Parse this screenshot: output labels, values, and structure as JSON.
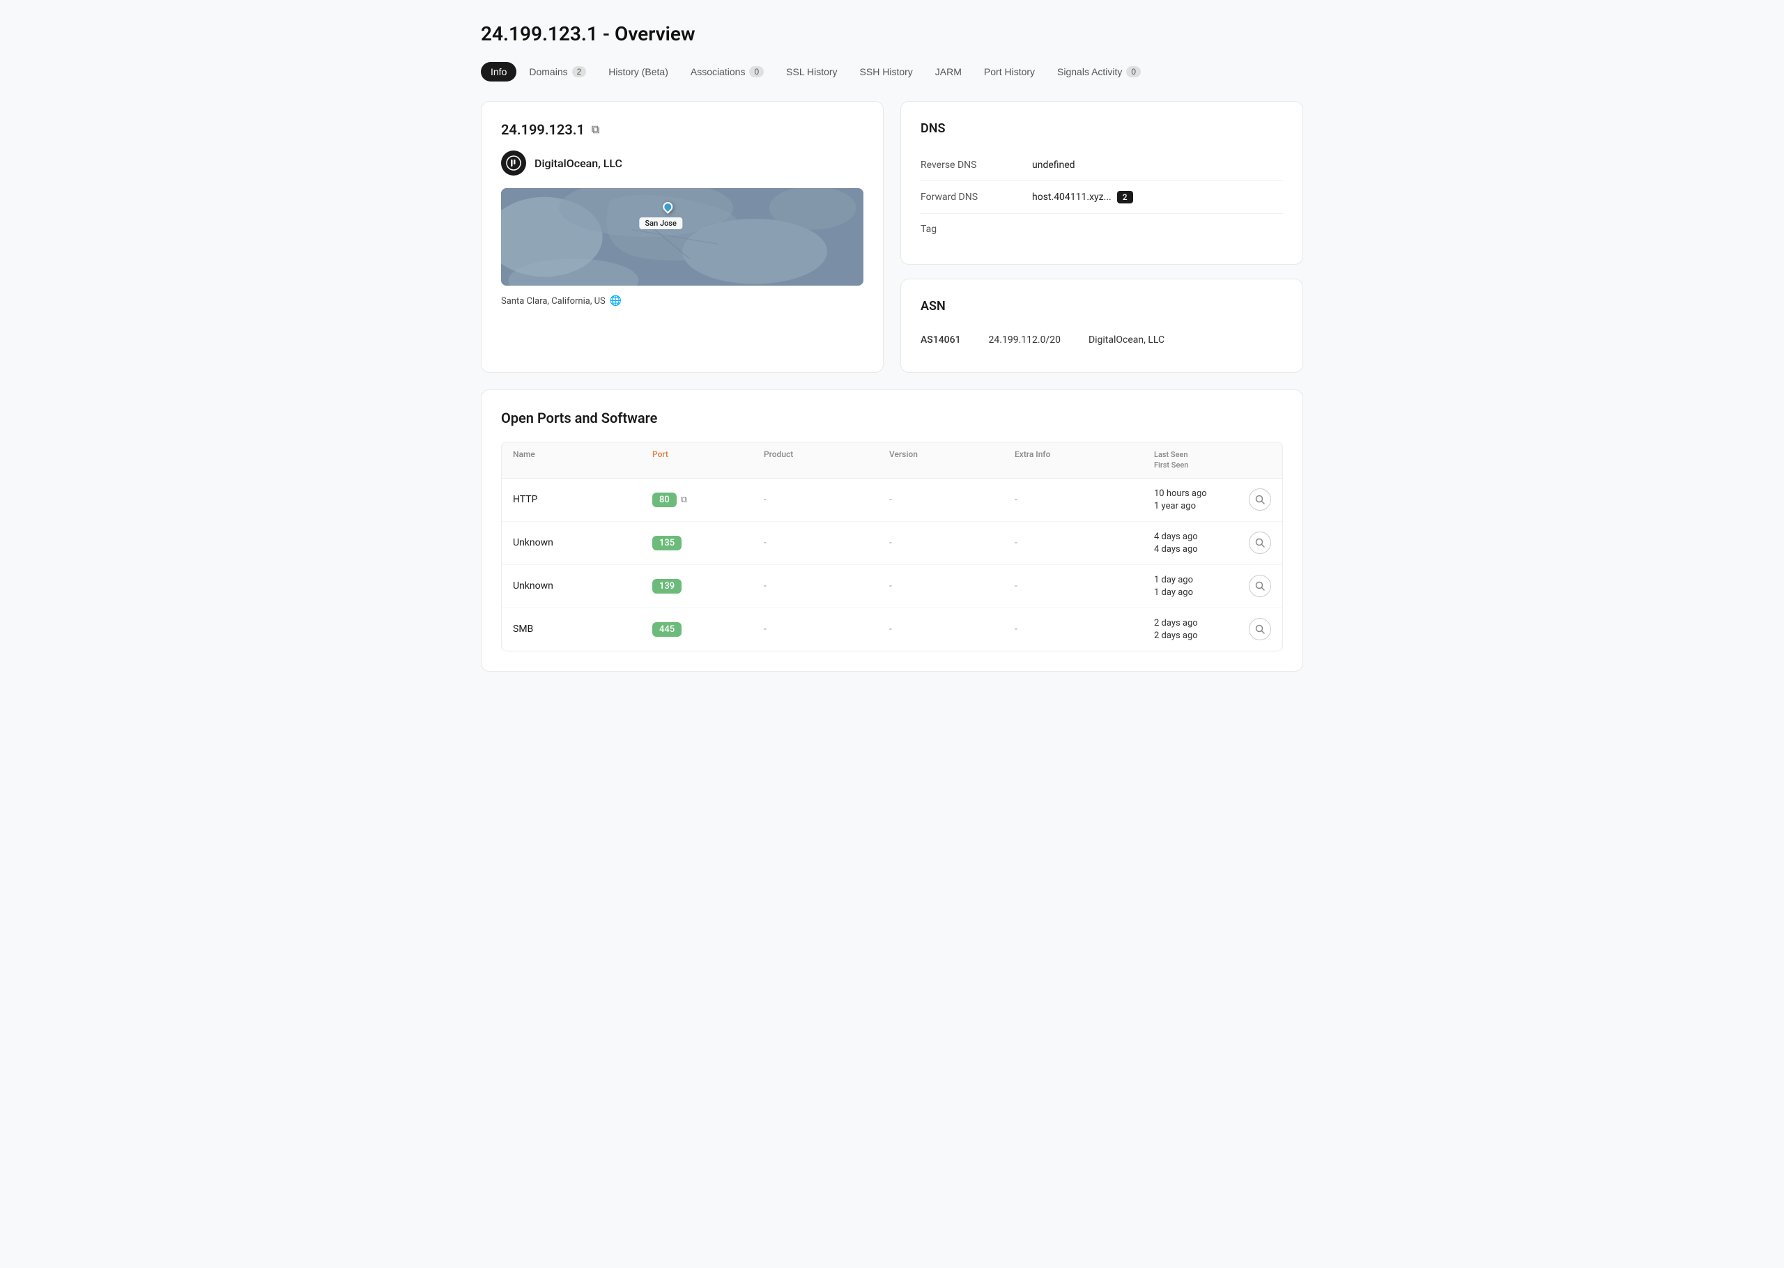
{
  "page": {
    "title": "24.199.123.1 - Overview"
  },
  "tabs": [
    {
      "id": "info",
      "label": "Info",
      "active": true,
      "badge": null
    },
    {
      "id": "domains",
      "label": "Domains",
      "active": false,
      "badge": "2"
    },
    {
      "id": "history",
      "label": "History (Beta)",
      "active": false,
      "badge": null
    },
    {
      "id": "associations",
      "label": "Associations",
      "active": false,
      "badge": "0"
    },
    {
      "id": "ssl-history",
      "label": "SSL History",
      "active": false,
      "badge": null
    },
    {
      "id": "ssh-history",
      "label": "SSH History",
      "active": false,
      "badge": null
    },
    {
      "id": "jarm",
      "label": "JARM",
      "active": false,
      "badge": null
    },
    {
      "id": "port-history",
      "label": "Port History",
      "active": false,
      "badge": null
    },
    {
      "id": "signals",
      "label": "Signals Activity",
      "active": false,
      "badge": "0"
    }
  ],
  "info_card": {
    "ip": "24.199.123.1",
    "org_name": "DigitalOcean, LLC",
    "org_logo_text": "◉",
    "map_label": "San Jose",
    "location": "Santa Clara, California, US"
  },
  "dns": {
    "title": "DNS",
    "rows": [
      {
        "label": "Reverse DNS",
        "value": "undefined",
        "badge": null
      },
      {
        "label": "Forward DNS",
        "value": "host.404111.xyz...",
        "badge": "2"
      },
      {
        "label": "Tag",
        "value": "",
        "badge": null
      }
    ]
  },
  "asn": {
    "title": "ASN",
    "id": "AS14061",
    "range": "24.199.112.0/20",
    "org": "DigitalOcean, LLC"
  },
  "open_ports": {
    "section_title": "Open Ports and Software",
    "columns": {
      "name": "Name",
      "port": "Port",
      "product": "Product",
      "version": "Version",
      "extra_info": "Extra Info",
      "last_seen": "Last Seen",
      "first_seen": "First Seen"
    },
    "rows": [
      {
        "name": "HTTP",
        "port": "80",
        "has_ext_link": true,
        "product": "-",
        "version": "-",
        "extra_info": "-",
        "last_seen": "10 hours ago",
        "first_seen": "1 year ago"
      },
      {
        "name": "Unknown",
        "port": "135",
        "has_ext_link": false,
        "product": "-",
        "version": "-",
        "extra_info": "-",
        "last_seen": "4 days ago",
        "first_seen": "4 days ago"
      },
      {
        "name": "Unknown",
        "port": "139",
        "has_ext_link": false,
        "product": "-",
        "version": "-",
        "extra_info": "-",
        "last_seen": "1 day ago",
        "first_seen": "1 day ago"
      },
      {
        "name": "SMB",
        "port": "445",
        "has_ext_link": false,
        "product": "-",
        "version": "-",
        "extra_info": "-",
        "last_seen": "2 days ago",
        "first_seen": "2 days ago"
      }
    ]
  }
}
